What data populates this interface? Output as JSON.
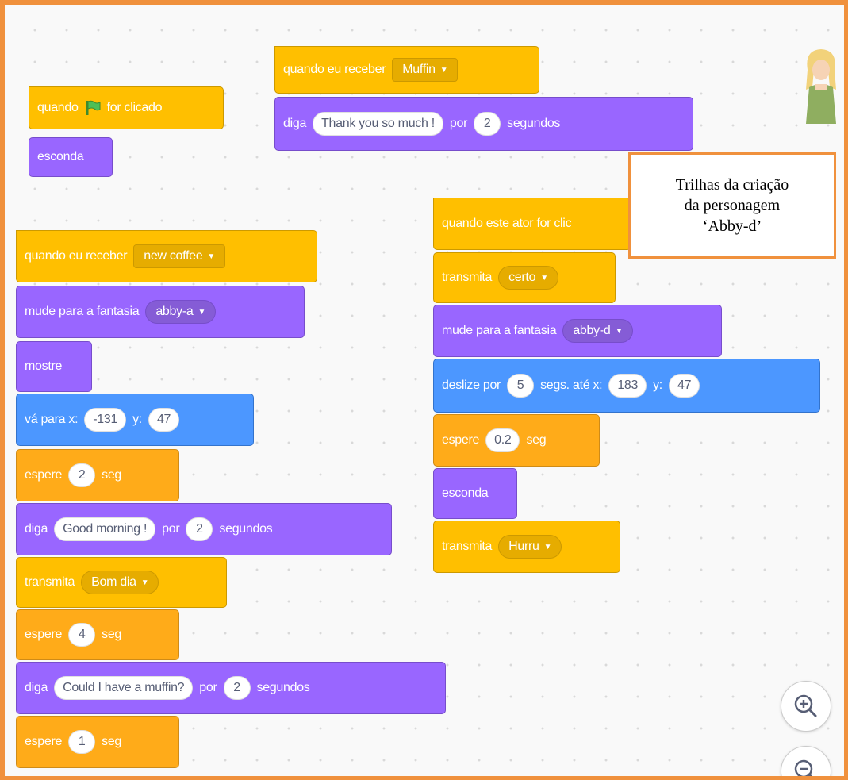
{
  "note": {
    "line1": "Trilhas da criação",
    "line2": "da personagem",
    "line3": "‘Abby-d’"
  },
  "scripts": {
    "flag_script": {
      "hat_when": "quando",
      "hat_clicked": "for clicado",
      "hide": "esconda"
    },
    "muffin_script": {
      "hat_label": "quando eu receber",
      "hat_message": "Muffin",
      "say_label": "diga",
      "say_text": "Thank you so much !",
      "say_for": "por",
      "say_secs": "2",
      "say_unit": "segundos"
    },
    "coffee_script": {
      "hat_label": "quando eu receber",
      "hat_message": "new coffee",
      "costume_label": "mude para a fantasia",
      "costume_value": "abby-a",
      "show": "mostre",
      "goto_label": "vá para x:",
      "goto_x": "-131",
      "goto_y_label": "y:",
      "goto_y": "47",
      "wait1_label": "espere",
      "wait1_value": "2",
      "wait1_unit": "seg",
      "say1_label": "diga",
      "say1_text": "Good morning !",
      "say1_for": "por",
      "say1_secs": "2",
      "say1_unit": "segundos",
      "broadcast_label": "transmita",
      "broadcast_value": "Bom dia",
      "wait2_label": "espere",
      "wait2_value": "4",
      "wait2_unit": "seg",
      "say2_label": "diga",
      "say2_text": "Could I have a muffin?",
      "say2_for": "por",
      "say2_secs": "2",
      "say2_unit": "segundos",
      "wait3_label": "espere",
      "wait3_value": "1",
      "wait3_unit": "seg"
    },
    "click_script": {
      "hat_label": "quando este ator for clic",
      "broadcast1_label": "transmita",
      "broadcast1_value": "certo",
      "costume_label": "mude para a fantasia",
      "costume_value": "abby-d",
      "glide_label": "deslize por",
      "glide_secs": "5",
      "glide_to": "segs. até x:",
      "glide_x": "183",
      "glide_y_label": "y:",
      "glide_y": "47",
      "wait_label": "espere",
      "wait_value": "0.2",
      "wait_unit": "seg",
      "hide": "esconda",
      "broadcast2_label": "transmita",
      "broadcast2_value": "Hurru"
    }
  },
  "icons": {
    "flag": "green-flag-icon",
    "dropdown": "caret-down-icon",
    "zoom_in": "zoom-in-icon",
    "zoom_out": "zoom-out-icon",
    "sprite": "abby-sprite-thumbnail"
  },
  "colors": {
    "events": "#FFBF00",
    "looks": "#9966FF",
    "control": "#FFAB19",
    "motion": "#4C97FF",
    "frame_border": "#F0913D"
  }
}
